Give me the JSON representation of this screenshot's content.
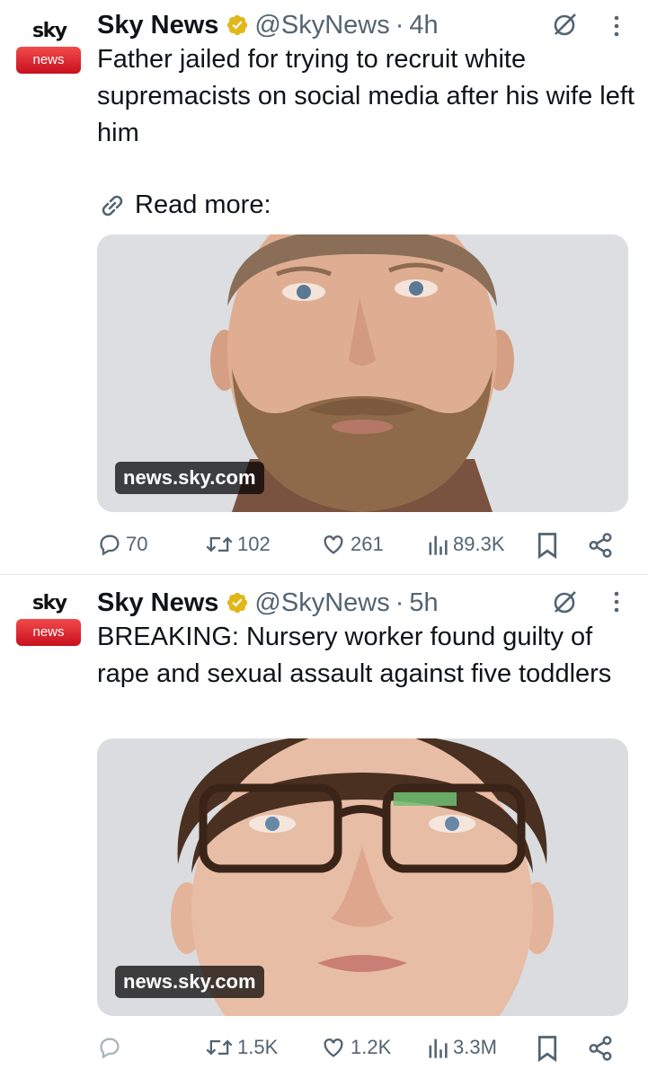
{
  "tweets": [
    {
      "avatar": {
        "wordmark": "sky",
        "pill": "news"
      },
      "name": "Sky News",
      "handle": "@SkyNews",
      "separator": "·",
      "time": "4h",
      "text": "Father jailed for trying to recruit white supremacists on social media after his wife left him",
      "link_label": "Read more:",
      "card_domain": "news.sky.com",
      "stats": {
        "replies": "70",
        "reposts": "102",
        "likes": "261",
        "views": "89.3K"
      }
    },
    {
      "avatar": {
        "wordmark": "sky",
        "pill": "news"
      },
      "name": "Sky News",
      "handle": "@SkyNews",
      "separator": "·",
      "time": "5h",
      "text": "BREAKING: Nursery worker found guilty of rape and sexual assault against five toddlers",
      "card_domain": "news.sky.com",
      "stats": {
        "replies": "",
        "reposts": "1.5K",
        "likes": "1.2K",
        "views": "3.3M"
      }
    }
  ],
  "icons": [
    "verified-badge-icon",
    "grok-icon",
    "more-options-icon",
    "link-icon",
    "reply-icon",
    "repost-icon",
    "like-icon",
    "views-icon",
    "bookmark-icon",
    "share-icon"
  ],
  "colors": {
    "verified_gold": "#e2b719",
    "text": "#0f1419",
    "secondary": "#536471",
    "sky_red": "#d9141f"
  }
}
